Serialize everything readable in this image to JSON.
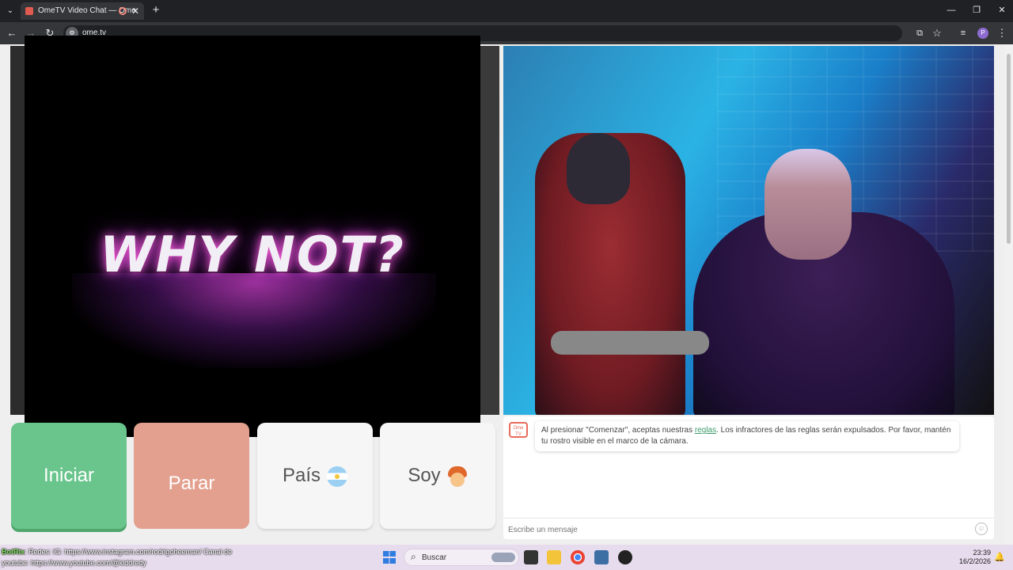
{
  "browser": {
    "tab_title": "OmeTV Video Chat — Ome",
    "tab_close": "✕",
    "new_tab": "+",
    "url": "ome.tv",
    "profile_initial": "P",
    "window_controls": [
      "—",
      "❐",
      "✕"
    ]
  },
  "video": {
    "overlay_text": "WHY NOT?"
  },
  "controls": {
    "start_label": "Iniciar",
    "stop_label": "Parar",
    "country_label": "País",
    "soy_label": "Soy"
  },
  "chat": {
    "logo_text": "Ome TV",
    "notice_before": "Al presionar \"Comenzar\", aceptas nuestras ",
    "notice_link": "reglas",
    "notice_after": ". Los infractores de las reglas serán expulsados. Por favor, mantén tu rostro visible en el marco de la cámara.",
    "input_placeholder": "Escribe un mensaje",
    "emoji_icon": "☺"
  },
  "overlay_ticker": {
    "bot_name": "BotRix",
    "line1": ": Redes: IG: https://www.instagram.com/rodrigoheeman/ Canal de",
    "line2": "youtube: https://www.youtube.com/@kiddredy"
  },
  "taskbar": {
    "search_label": "Buscar",
    "time": "23:39",
    "date": "16/2/2026"
  },
  "colors": {
    "start": "#6ac58d",
    "stop": "#e3a08e",
    "accent_link": "#3a9a6a",
    "brand": "#e86b5c"
  }
}
